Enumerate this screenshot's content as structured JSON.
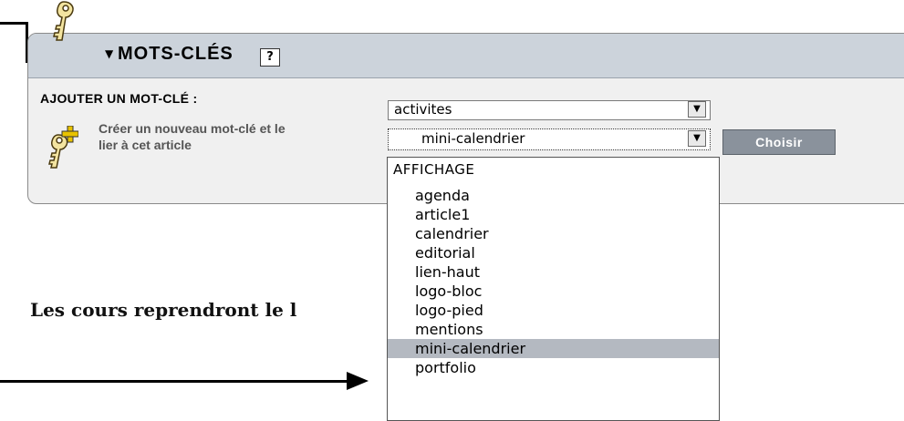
{
  "panel": {
    "title": "MOTS-CLÉS",
    "collapse_icon": "triangle-down-icon",
    "help_label": "?",
    "key_icon": "key-icon"
  },
  "form": {
    "add_label": "AJOUTER UN MOT-CLÉ :",
    "create_link": "Créer un nouveau mot-clé et le lier à cet article",
    "create_icon": "key-plus-icon",
    "group_select_value": "activites",
    "keyword_select_value": "mini-calendrier",
    "choose_button": "Choisir"
  },
  "dropdown": {
    "group_label": "AFFICHAGE",
    "options": [
      "agenda",
      "article1",
      "calendrier",
      "editorial",
      "lien-haut",
      "logo-bloc",
      "logo-pied",
      "mentions",
      "mini-calendrier",
      "portfolio"
    ],
    "selected": "mini-calendrier"
  },
  "content": {
    "paragraph": "Les cours reprendront le l"
  },
  "colors": {
    "header_bg": "#ccd3db",
    "panel_bg": "#f0f0f0",
    "button_bg": "#8a929c",
    "highlight": "#b4b9c1"
  }
}
